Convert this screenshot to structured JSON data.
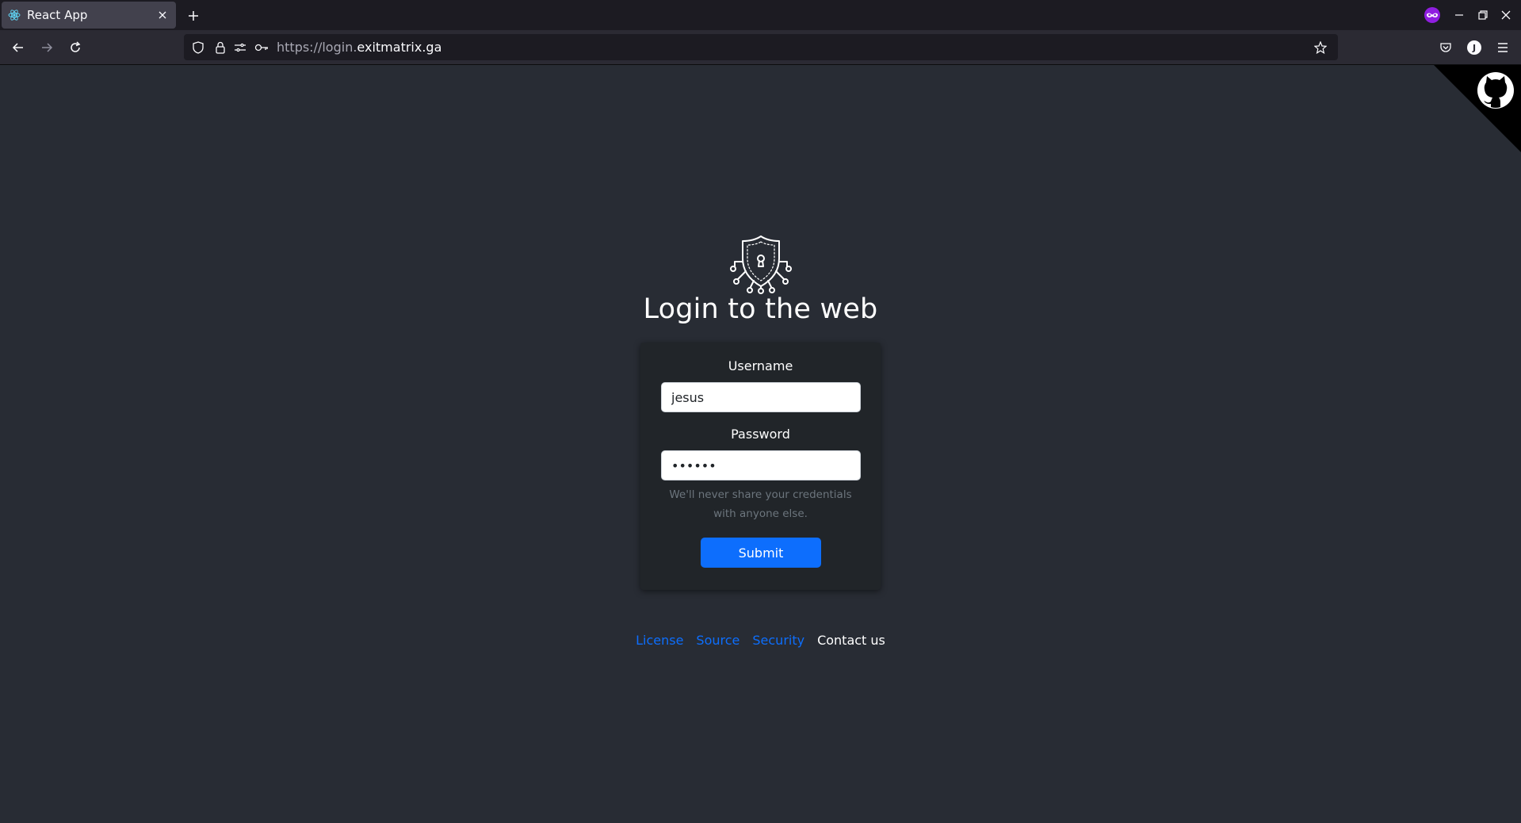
{
  "browser": {
    "tab_title": "React App",
    "url_prefix": "https://login.",
    "url_domain": "exitmatrix.ga",
    "profile_initial": "J"
  },
  "login": {
    "heading": "Login to the web",
    "username_label": "Username",
    "username_value": "jesus",
    "password_label": "Password",
    "password_value": "123456",
    "help_text": "We'll never share your credentials with anyone else.",
    "submit_label": "Submit"
  },
  "footer": {
    "links": [
      "License",
      "Source",
      "Security"
    ],
    "contact": "Contact us"
  },
  "colors": {
    "page_bg": "#282c34",
    "card_bg": "#212529",
    "accent": "#0d6efd"
  }
}
